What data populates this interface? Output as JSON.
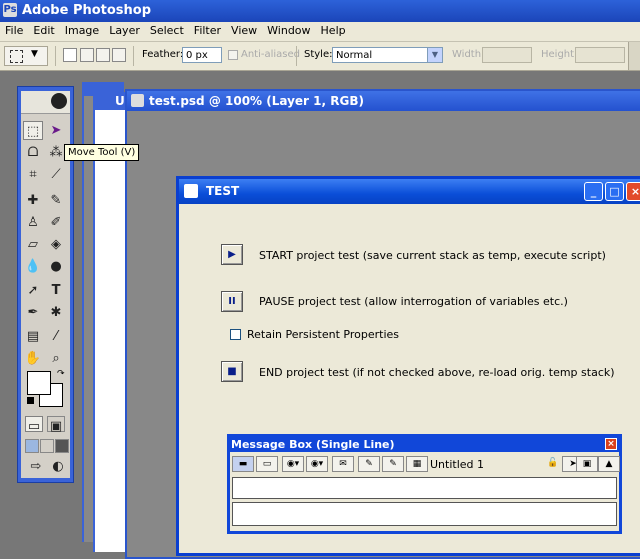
{
  "app": {
    "title": "Adobe Photoshop",
    "menu": [
      "File",
      "Edit",
      "Image",
      "Layer",
      "Select",
      "Filter",
      "View",
      "Window",
      "Help"
    ]
  },
  "options_bar": {
    "feather_label": "Feather:",
    "feather_value": "0 px",
    "anti_aliased_label": "Anti-aliased",
    "style_label": "Style:",
    "style_value": "Normal",
    "width_label": "Width:",
    "height_label": "Height:"
  },
  "tooltip": "Move Tool (V)",
  "background_docs": {
    "doc2_letter": "U"
  },
  "document": {
    "title": "test.psd @ 100% (Layer 1, RGB)"
  },
  "test_window": {
    "title": "TEST",
    "start_label": "START project test (save current stack as temp, execute script)",
    "pause_label": "PAUSE project test (allow interrogation of variables etc.)",
    "retain_label": "Retain Persistent Properties",
    "retain_checked": false,
    "end_label": "END project test (if not checked above, re-load orig. temp stack)"
  },
  "message_box": {
    "title": "Message Box (Single Line)",
    "stack_name": "Untitled 1"
  },
  "icons": {
    "close": "×",
    "minimize": "_",
    "maximize": "□"
  }
}
